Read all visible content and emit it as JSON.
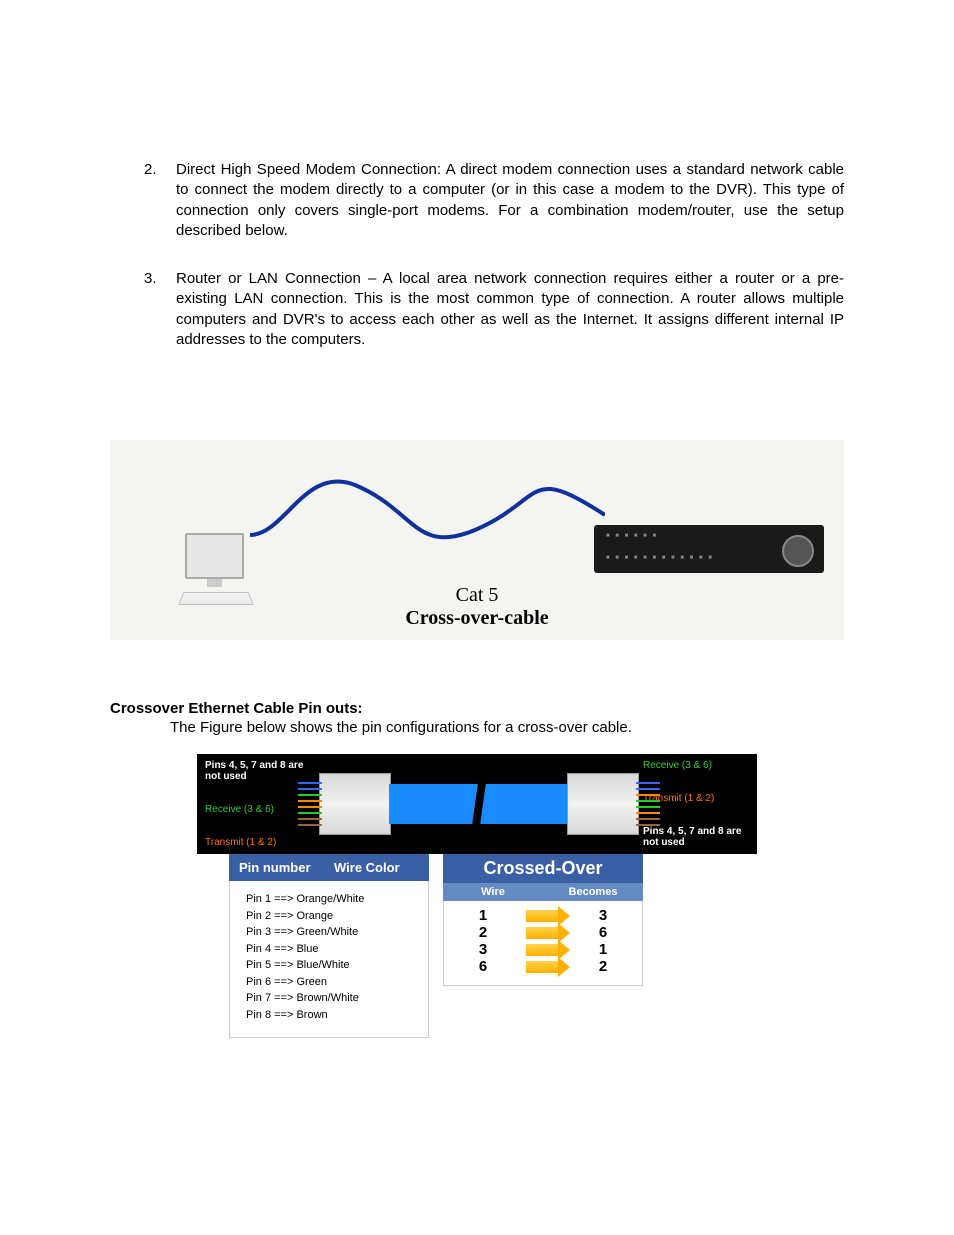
{
  "list": {
    "item2_num": "2.",
    "item2_text": "Direct High Speed Modem Connection: A direct modem connection uses a standard network cable to connect the modem directly to a computer (or in this case a modem to the DVR). This type of connection only covers single-port modems. For a combination modem/router, use the setup described below.",
    "item3_num": "3.",
    "item3_text": "Router or LAN Connection – A local area network connection requires either a router or a pre-existing LAN connection. This is the most common type of connection. A router allows multiple computers and DVR's to access each other as well as the Internet. It assigns different internal IP addresses to the computers."
  },
  "diagram1": {
    "caption_line1": "Cat 5",
    "caption_line2": "Cross-over-cable"
  },
  "section": {
    "heading": "Crossover Ethernet Cable Pin outs:",
    "text": "The Figure below shows the pin configurations for a cross-over cable."
  },
  "diagram2": {
    "left_labels": {
      "unused": "Pins 4, 5, 7 and 8 are not used",
      "receive": "Receive (3 & 6)",
      "transmit": "Transmit (1 & 2)"
    },
    "right_labels": {
      "receive": "Receive (3 & 6)",
      "transmit": "Transmit (1 & 2)",
      "unused": "Pins 4, 5, 7 and 8 are not used"
    },
    "panel1": {
      "h1": "Pin number",
      "h2": "Wire Color",
      "rows": [
        "Pin 1 ==> Orange/White",
        "Pin 2 ==> Orange",
        "Pin 3 ==> Green/White",
        "Pin 4 ==> Blue",
        "Pin 5 ==> Blue/White",
        "Pin 6 ==> Green",
        "Pin 7 ==> Brown/White",
        "Pin 8 ==> Brown"
      ]
    },
    "panel2": {
      "title": "Crossed-Over",
      "sub1": "Wire",
      "sub2": "Becomes",
      "rows": [
        {
          "from": "1",
          "to": "3"
        },
        {
          "from": "2",
          "to": "6"
        },
        {
          "from": "3",
          "to": "1"
        },
        {
          "from": "6",
          "to": "2"
        }
      ]
    }
  }
}
